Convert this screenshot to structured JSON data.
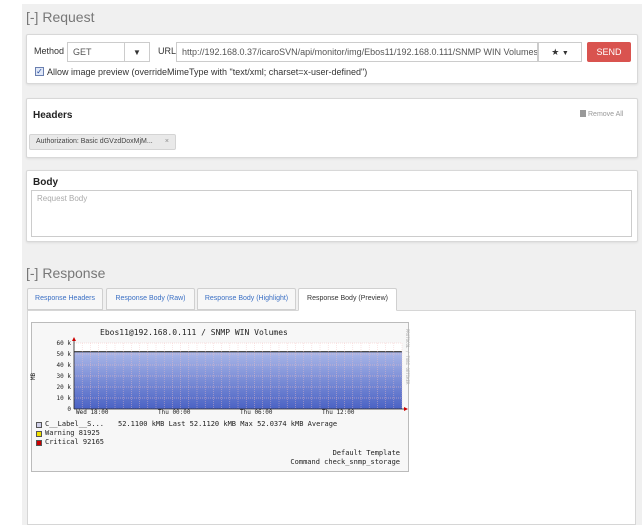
{
  "request": {
    "section_title": "[-] Request",
    "method_label": "Method",
    "method_value": "GET",
    "url_label": "URL",
    "url_value": "http://192.168.0.37/icaroSVN/api/monitor/img/Ebos11/192.168.0.111/SNMP WIN Volumes:0",
    "send_label": "SEND",
    "allow_preview_label": "Allow image preview (overrideMimeType with \"text/xml; charset=x-user-defined\")",
    "allow_preview_checked": true
  },
  "headers": {
    "title": "Headers",
    "remove_all_label": "Remove All",
    "items": [
      {
        "text": "Authorization: Basic dGVzdDoxMjM...",
        "close": "×"
      }
    ]
  },
  "body": {
    "title": "Body",
    "placeholder": "Request Body"
  },
  "response": {
    "section_title": "[-] Response",
    "tabs": [
      "Response Headers",
      "Response Body (Raw)",
      "Response Body (Highlight)",
      "Response Body (Preview)"
    ],
    "active_tab": "Response Body (Preview)"
  },
  "graph": {
    "title": "Ebos11@192.168.0.111 / SNMP WIN Volumes",
    "side_label": "PROTOCOL / TOBI OETIKER",
    "ylabel": "MB",
    "yticks": [
      "60 k",
      "50 k",
      "40 k",
      "30 k",
      "20 k",
      "10 k",
      "0"
    ],
    "xticks": [
      "Wed 18:00",
      "Thu 00:00",
      "Thu 06:00",
      "Thu 12:00"
    ],
    "legend": [
      {
        "name": "C__Label__S...",
        "stats": "52.1100 kMB Last  52.1120 kMB Max  52.0374 kMB Average",
        "color": "#cfcfe8"
      },
      {
        "name": "Warning  81925",
        "stats": "",
        "color": "#f0e000"
      },
      {
        "name": "Critical 92165",
        "stats": "",
        "color": "#cc0000"
      }
    ],
    "footer_line1": "Default Template",
    "footer_line2": "Command check_snmp_storage"
  },
  "chart_data": {
    "type": "area",
    "title": "Ebos11@192.168.0.111 / SNMP WIN Volumes",
    "ylabel": "MB",
    "ylim": [
      0,
      60000
    ],
    "x": [
      "Wed 18:00",
      "Thu 00:00",
      "Thu 06:00",
      "Thu 12:00"
    ],
    "series": [
      {
        "name": "C__Label__S...",
        "values": [
          52100,
          52100,
          52100,
          52100
        ],
        "color": "#4a62c4"
      }
    ]
  },
  "colors": {
    "send": "#d9534f",
    "link": "#3a6fc4",
    "area": "#4a62c4"
  }
}
